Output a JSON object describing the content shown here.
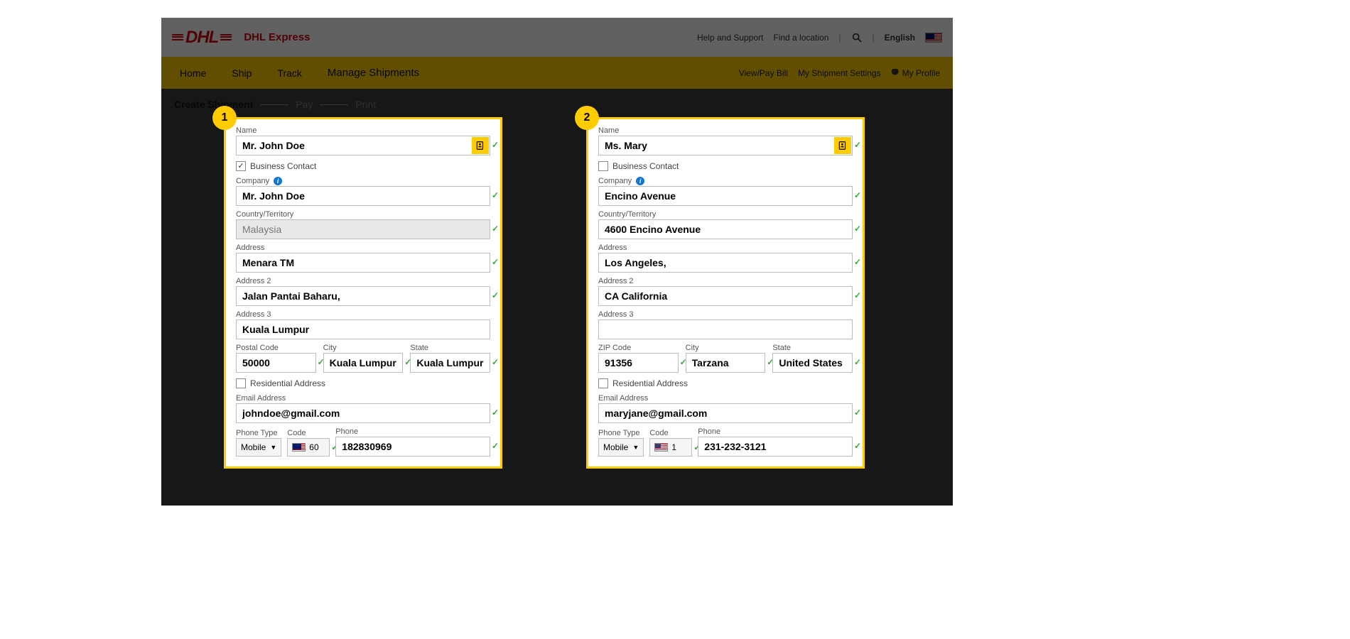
{
  "header": {
    "brand": "DHL",
    "subbrand": "DHL Express",
    "help": "Help and Support",
    "find_location": "Find a location",
    "language": "English"
  },
  "nav": {
    "home": "Home",
    "ship": "Ship",
    "track": "Track",
    "manage": "Manage Shipments",
    "view_pay": "View/Pay Bill",
    "ship_settings": "My Shipment Settings",
    "profile": "My Profile"
  },
  "breadcrumb": {
    "current": "Create Shipment",
    "step2": "Pay",
    "step3": "Print"
  },
  "labels": {
    "name": "Name",
    "business_contact": "Business Contact",
    "company": "Company",
    "country": "Country/Territory",
    "address": "Address",
    "address2": "Address 2",
    "address3": "Address 3",
    "postal_code": "Postal Code",
    "zip_code": "ZIP Code",
    "city": "City",
    "state": "State",
    "residential": "Residential Address",
    "email": "Email Address",
    "phone_type": "Phone Type",
    "code": "Code",
    "phone": "Phone"
  },
  "badge": {
    "one": "1",
    "two": "2"
  },
  "from": {
    "name": "Mr. John Doe",
    "business_contact": true,
    "company": "Mr. John Doe",
    "country": "Malaysia",
    "address": "Menara TM",
    "address2": "Jalan Pantai Baharu,",
    "address3": "Kuala Lumpur",
    "postal_code": "50000",
    "city": "Kuala Lumpur",
    "state": "Kuala Lumpur",
    "residential": false,
    "email": "johndoe@gmail.com",
    "phone_type": "Mobile",
    "phone_code": "60",
    "phone": "182830969"
  },
  "to": {
    "name": "Ms. Mary",
    "business_contact": false,
    "company": "Encino Avenue",
    "country": "4600 Encino Avenue",
    "address": "Los Angeles,",
    "address2": "CA California",
    "address3": "",
    "postal_code": "91356",
    "city": "Tarzana",
    "state": "United States",
    "residential": false,
    "email": "maryjane@gmail.com",
    "phone_type": "Mobile",
    "phone_code": "1",
    "phone": "231-232-3121"
  }
}
